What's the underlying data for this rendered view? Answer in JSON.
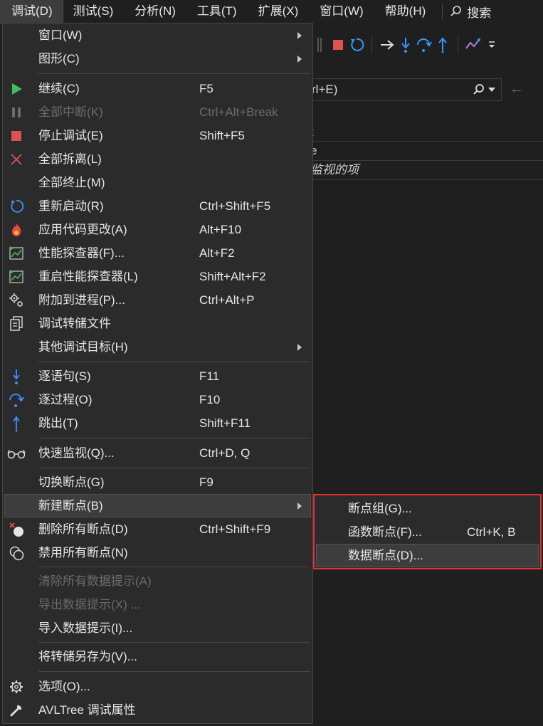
{
  "menubar": {
    "items": [
      "调试(D)",
      "测试(S)",
      "分析(N)",
      "工具(T)",
      "扩展(X)",
      "窗口(W)",
      "帮助(H)"
    ],
    "search_label": "搜索"
  },
  "background": {
    "search_text": "rl+E)",
    "watch_header": "t",
    "watch_row1": "e",
    "watch_row2": "监视的项"
  },
  "debug_menu": {
    "items": [
      {
        "label": "窗口(W)",
        "shortcut": ""
      },
      {
        "label": "图形(C)",
        "shortcut": ""
      },
      {
        "label": "继续(C)",
        "shortcut": "F5"
      },
      {
        "label": "全部中断(K)",
        "shortcut": "Ctrl+Alt+Break"
      },
      {
        "label": "停止调试(E)",
        "shortcut": "Shift+F5"
      },
      {
        "label": "全部拆离(L)",
        "shortcut": ""
      },
      {
        "label": "全部终止(M)",
        "shortcut": ""
      },
      {
        "label": "重新启动(R)",
        "shortcut": "Ctrl+Shift+F5"
      },
      {
        "label": "应用代码更改(A)",
        "shortcut": "Alt+F10"
      },
      {
        "label": "性能探查器(F)...",
        "shortcut": "Alt+F2"
      },
      {
        "label": "重启性能探查器(L)",
        "shortcut": "Shift+Alt+F2"
      },
      {
        "label": "附加到进程(P)...",
        "shortcut": "Ctrl+Alt+P"
      },
      {
        "label": "调试转储文件",
        "shortcut": ""
      },
      {
        "label": "其他调试目标(H)",
        "shortcut": ""
      },
      {
        "label": "逐语句(S)",
        "shortcut": "F11"
      },
      {
        "label": "逐过程(O)",
        "shortcut": "F10"
      },
      {
        "label": "跳出(T)",
        "shortcut": "Shift+F11"
      },
      {
        "label": "快速监视(Q)...",
        "shortcut": "Ctrl+D, Q"
      },
      {
        "label": "切换断点(G)",
        "shortcut": "F9"
      },
      {
        "label": "新建断点(B)",
        "shortcut": ""
      },
      {
        "label": "删除所有断点(D)",
        "shortcut": "Ctrl+Shift+F9"
      },
      {
        "label": "禁用所有断点(N)",
        "shortcut": ""
      },
      {
        "label": "清除所有数据提示(A)",
        "shortcut": ""
      },
      {
        "label": "导出数据提示(X) ...",
        "shortcut": ""
      },
      {
        "label": "导入数据提示(I)...",
        "shortcut": ""
      },
      {
        "label": "将转储另存为(V)...",
        "shortcut": ""
      },
      {
        "label": "选项(O)...",
        "shortcut": ""
      },
      {
        "label": "AVLTree 调试属性",
        "shortcut": ""
      }
    ]
  },
  "new_breakpoint_submenu": {
    "items": [
      {
        "label": "断点组(G)...",
        "shortcut": ""
      },
      {
        "label": "函数断点(F)...",
        "shortcut": "Ctrl+K, B"
      },
      {
        "label": "数据断点(D)...",
        "shortcut": ""
      }
    ]
  },
  "colors": {
    "menu_bg": "#2b2b2b",
    "highlight_bg": "#3d3d3d",
    "accent_blue": "#3794ff",
    "continue_green": "#3fbf5a",
    "stop_red": "#e05252",
    "annotation_red": "#e03030",
    "disabled_text": "#6b6b6b"
  }
}
